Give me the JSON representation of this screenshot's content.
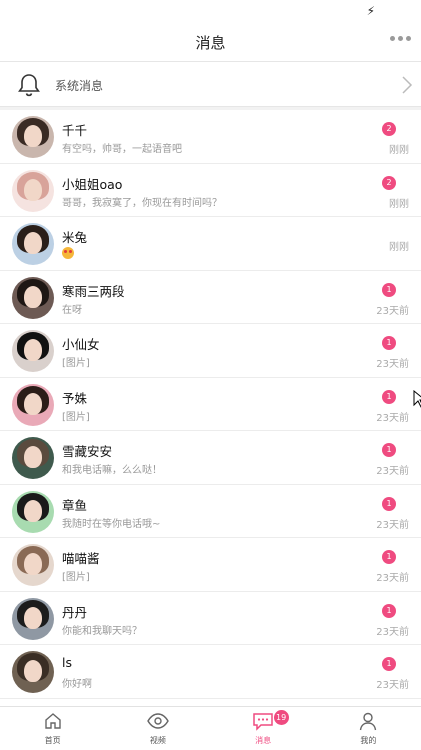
{
  "header": {
    "title": "消息"
  },
  "system": {
    "label": "系统消息"
  },
  "conversations": [
    {
      "name": "千千",
      "preview": "有空吗，帅哥，一起语音吧",
      "badge": "2",
      "time": "刚刚",
      "hair": "#3a2b24",
      "bg": "#c9b6ad"
    },
    {
      "name": "小姐姐oao",
      "preview": "哥哥，我寂寞了，你现在有时间吗？",
      "badge": "2",
      "time": "刚刚",
      "hair": "#d8a39a",
      "bg": "#f5e3e0"
    },
    {
      "name": "米兔",
      "preview": "",
      "emoji": true,
      "badge": "",
      "time": "刚刚",
      "hair": "#2a1f1a",
      "bg": "#bcd0e4"
    },
    {
      "name": "寒雨三两段",
      "preview": "在呀",
      "badge": "1",
      "time": "23天前",
      "hair": "#1e1714",
      "bg": "#6d5a54"
    },
    {
      "name": "小仙女",
      "preview": "[图片]",
      "badge": "1",
      "time": "23天前",
      "hair": "#111111",
      "bg": "#d9d0cc"
    },
    {
      "name": "予姝",
      "preview": "[图片]",
      "badge": "1",
      "time": "23天前",
      "hair": "#2b1d18",
      "bg": "#e9a9b7"
    },
    {
      "name": "雪藏安安",
      "preview": "和我电话嘛，么么哒！",
      "badge": "1",
      "time": "23天前",
      "hair": "#5a4b3e",
      "bg": "#3f5a4d"
    },
    {
      "name": "章鱼",
      "preview": "我随时在等你电话哦~",
      "badge": "1",
      "time": "23天前",
      "hair": "#1a1a1a",
      "bg": "#a8dbb0"
    },
    {
      "name": "喵喵酱",
      "preview": "[图片]",
      "badge": "1",
      "time": "23天前",
      "hair": "#8a6a55",
      "bg": "#e5d7cd"
    },
    {
      "name": "丹丹",
      "preview": "你能和我聊天吗？",
      "badge": "1",
      "time": "23天前",
      "hair": "#1c1c1c",
      "bg": "#8f98a3"
    },
    {
      "name": "ls",
      "preview": "你好啊",
      "badge": "1",
      "time": "23天前",
      "hair": "#3a2e25",
      "bg": "#6f6152"
    }
  ],
  "tabs": [
    {
      "label": "首页",
      "icon": "home-icon",
      "active": false
    },
    {
      "label": "视频",
      "icon": "eye-icon",
      "active": false
    },
    {
      "label": "消息",
      "icon": "chat-icon",
      "active": true,
      "badge": "19"
    },
    {
      "label": "我的",
      "icon": "person-icon",
      "active": false
    }
  ],
  "colors": {
    "accent": "#ef4b80",
    "divider": "#ececec"
  }
}
